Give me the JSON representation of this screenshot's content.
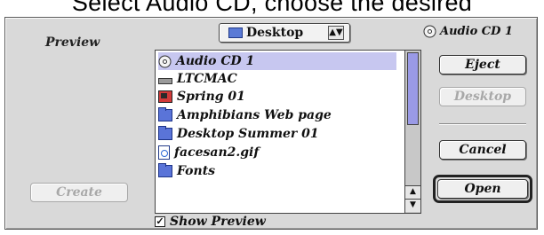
{
  "caption": "Select Audio CD, choose the desired",
  "dialog": {
    "preview_label": "Preview",
    "location_popup": {
      "selected": "Desktop",
      "icon": "folder-icon"
    },
    "volume_label": "Audio CD 1",
    "file_list": [
      {
        "name": "Audio CD 1",
        "icon": "cd-icon",
        "selected": true
      },
      {
        "name": "LTCMAC",
        "icon": "drive-icon",
        "selected": false
      },
      {
        "name": "Spring 01",
        "icon": "image-file-icon",
        "selected": false
      },
      {
        "name": "Amphibians Web page",
        "icon": "folder-icon",
        "selected": false
      },
      {
        "name": "Desktop Summer 01",
        "icon": "folder-icon",
        "selected": false
      },
      {
        "name": "facesan2.gif",
        "icon": "gif-file-icon",
        "selected": false
      },
      {
        "name": "Fonts",
        "icon": "folder-icon",
        "selected": false
      }
    ],
    "buttons": {
      "eject": "Eject",
      "desktop": "Desktop",
      "cancel": "Cancel",
      "open": "Open",
      "create": "Create"
    },
    "show_preview": {
      "label": "Show Preview",
      "checked": true
    }
  }
}
